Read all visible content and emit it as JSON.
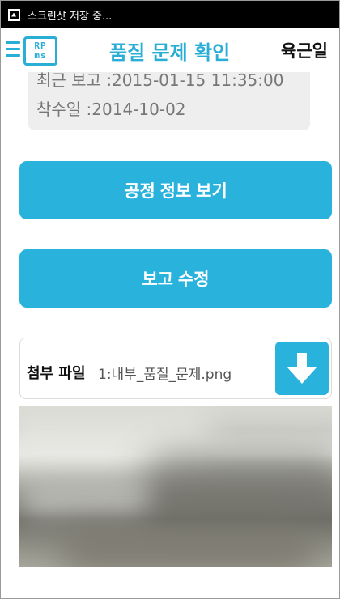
{
  "status_bar": {
    "icon": "screenshot-icon",
    "text": "스크린샷 저장 중..."
  },
  "app_bar": {
    "menu_icon": "hamburger-menu-icon",
    "logo_text_top": "RP",
    "logo_text_bottom": "ms",
    "title": "품질 문제 확인",
    "user_name": "육근일",
    "accent_color": "#2aaed6"
  },
  "info": {
    "last_report": "최근 보고 :2015-01-15 11:35:00",
    "start_date": "착수일 :2014-10-02"
  },
  "buttons": {
    "view_process": "공정 정보 보기",
    "edit_report": "보고 수정",
    "button_color": "#29b2dc"
  },
  "attachment": {
    "label": "첨부 파일",
    "file": "1:내부_품질_문제.png",
    "download_icon": "download-arrow-icon"
  },
  "preview": {
    "type": "blurred-photo"
  }
}
